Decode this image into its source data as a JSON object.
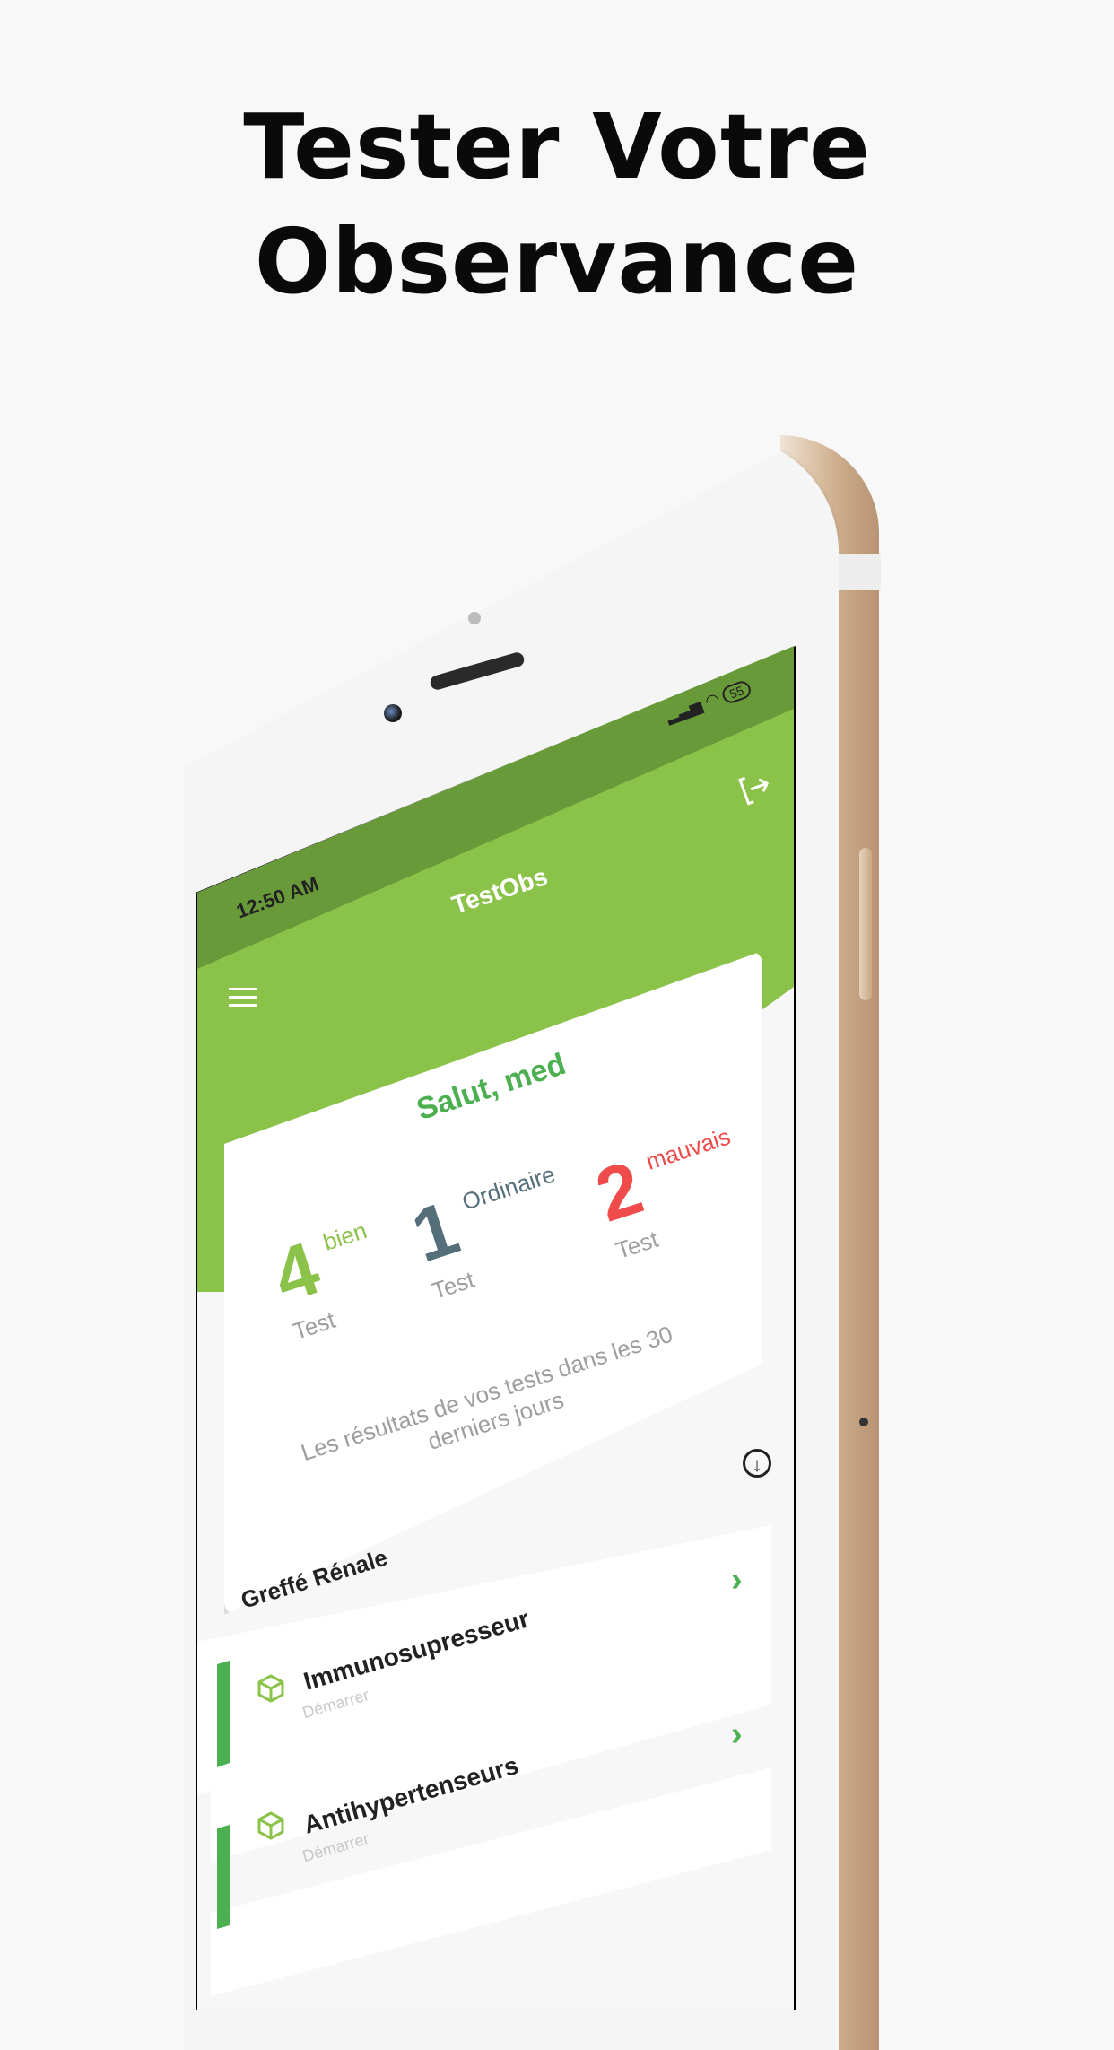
{
  "headline": {
    "line1": "Tester Votre",
    "line2": "Observance"
  },
  "status_bar": {
    "time": "12:50 AM",
    "battery": "55"
  },
  "app": {
    "title": "TestObs"
  },
  "card": {
    "greeting": "Salut, med",
    "stats": [
      {
        "value": "4",
        "label": "bien",
        "sub": "Test",
        "color": "#8bc34a"
      },
      {
        "value": "1",
        "label": "Ordinaire",
        "sub": "Test",
        "color": "#546e7a"
      },
      {
        "value": "2",
        "label": "mauvais",
        "sub": "Test",
        "color": "#ef4b4b"
      }
    ],
    "footer": "Les résultats de vos tests dans les 30 derniers jours"
  },
  "list": {
    "section_title": "Greffé Rénale",
    "items": [
      {
        "title": "Immunosupresseur",
        "subtitle": "Démarrer"
      },
      {
        "title": "Antihypertenseurs",
        "subtitle": "Démarrer"
      }
    ]
  },
  "colors": {
    "primary": "#8bc34a",
    "primary_dark": "#689a3a",
    "accent": "#4caf50"
  },
  "icons": [
    "menu-icon",
    "logout-icon",
    "download-icon",
    "cube-icon",
    "chevron-right-icon",
    "signal-icon",
    "wifi-icon",
    "battery-icon"
  ]
}
